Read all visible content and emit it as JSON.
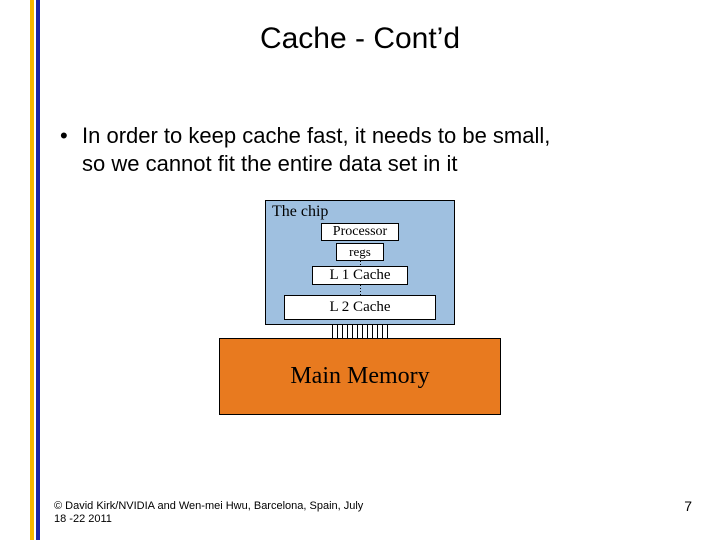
{
  "title": "Cache - Cont’d",
  "bullet": {
    "marker": "•",
    "line1": "In order to keep cache fast, it needs to be small,",
    "line2": "so we cannot fit the entire data set in it"
  },
  "diagram": {
    "chip_label": "The chip",
    "processor": "Processor",
    "regs": "regs",
    "l1": "L 1 Cache",
    "l2": "L 2 Cache",
    "main_memory": "Main Memory"
  },
  "footer": {
    "line1": "© David Kirk/NVIDIA and Wen-mei Hwu, Barcelona, Spain, July",
    "line2": "18 -22 2011"
  },
  "page_number": "7"
}
